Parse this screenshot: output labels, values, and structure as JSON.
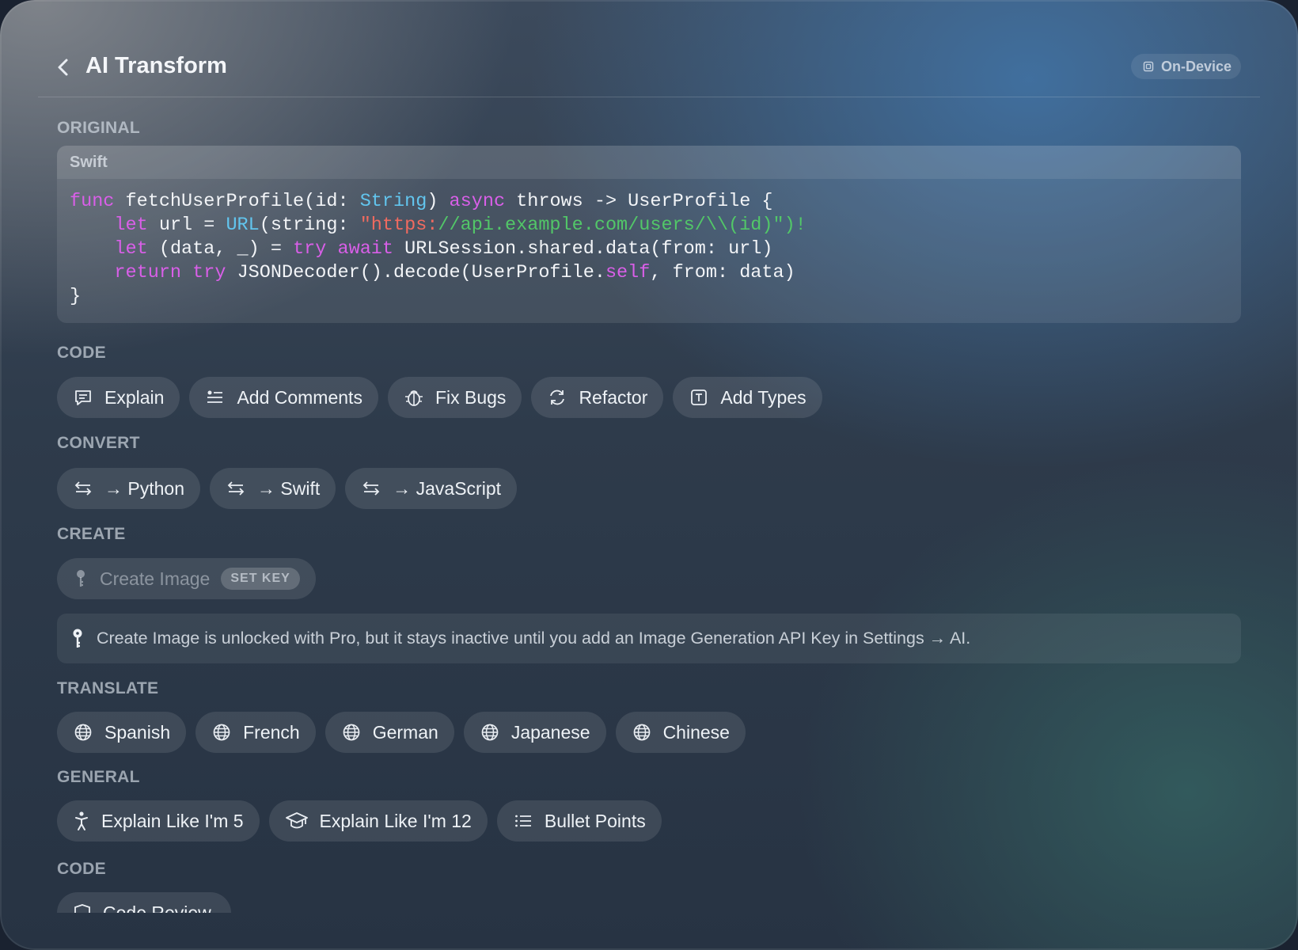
{
  "header": {
    "title": "AI Transform",
    "badge": "On-Device"
  },
  "original": {
    "section_label": "ORIGINAL",
    "language": "Swift"
  },
  "sections": {
    "code": "CODE",
    "convert": "CONVERT",
    "create": "CREATE",
    "translate": "TRANSLATE",
    "general": "GENERAL",
    "code2": "CODE"
  },
  "code_actions": [
    "Explain",
    "Add Comments",
    "Fix Bugs",
    "Refactor",
    "Add Types"
  ],
  "convert_actions": [
    "→ Python",
    "→ Swift",
    "→ JavaScript"
  ],
  "create_actions": {
    "label": "Create Image",
    "tag": "SET KEY"
  },
  "notice": "Create Image is unlocked with Pro, but it stays inactive until you add an Image Generation API Key in Settings → AI.",
  "translate_actions": [
    "Spanish",
    "French",
    "German",
    "Japanese",
    "Chinese"
  ],
  "general_actions": [
    "Explain Like I'm 5",
    "Explain Like I'm 12",
    "Bullet Points"
  ],
  "code2_actions": [
    "Code Review"
  ],
  "code_lines": {
    "l1": {
      "kw": "func",
      "a": " fetchUserProfile(id: ",
      "ty": "String",
      "b": ") ",
      "kw2": "async",
      "c": " throws -> UserProfile {"
    },
    "l2": {
      "ind": "    ",
      "kw": "let",
      "a": " url = ",
      "ty": "URL",
      "b": "(string: ",
      "s1": "\"https:",
      "s2": "//api.example.com/users/\\\\(id)\")!"
    },
    "l3": {
      "ind": "    ",
      "kw": "let",
      "a": " (data, _) = ",
      "kw2": "try",
      "sp": " ",
      "kw3": "await",
      "b": " URLSession.shared.data(from: url)"
    },
    "l4": {
      "ind": "    ",
      "kw": "return",
      "sp": " ",
      "kw2": "try",
      "a": " JSONDecoder().decode(UserProfile.",
      "kw3": "self",
      "b": ", from: data)"
    },
    "l5": {
      "a": "}"
    }
  }
}
